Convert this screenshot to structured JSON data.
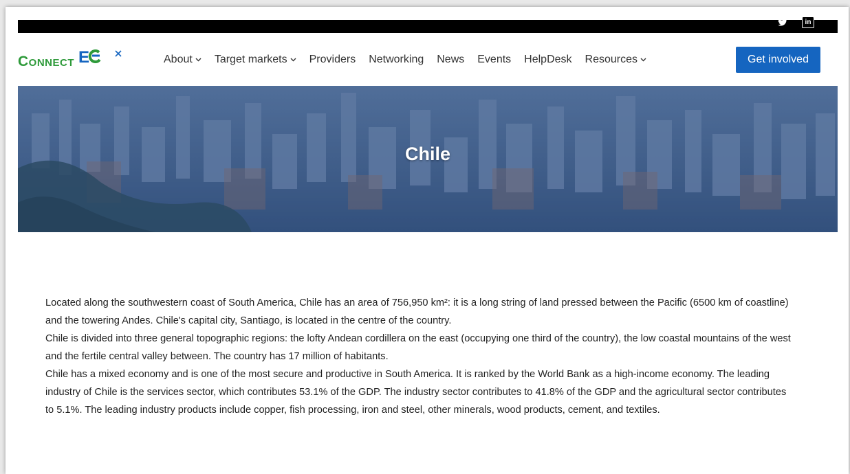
{
  "logo": {
    "connect": "Connect",
    "eo": "EO"
  },
  "nav": {
    "items": [
      {
        "label": "About",
        "dropdown": true
      },
      {
        "label": "Target markets",
        "dropdown": true
      },
      {
        "label": "Providers",
        "dropdown": false
      },
      {
        "label": "Networking",
        "dropdown": false
      },
      {
        "label": "News",
        "dropdown": false
      },
      {
        "label": "Events",
        "dropdown": false
      },
      {
        "label": "HelpDesk",
        "dropdown": false
      },
      {
        "label": "Resources",
        "dropdown": true
      }
    ],
    "cta": "Get involved"
  },
  "social": {
    "twitter_icon": "twitter-icon",
    "linkedin": "in"
  },
  "hero": {
    "title": "Chile"
  },
  "content": {
    "paragraphs": [
      "Located along the southwestern coast of South America, Chile has an area of 756,950 km²: it is a long string of land pressed between the Pacific (6500 km of coastline) and the towering Andes. Chile's capital city, Santiago, is located in the centre of the country.",
      "Chile is divided into three general topographic regions: the lofty Andean cordillera on the east (occupying one third of the country), the low coastal mountains of the west and the fertile central valley between. The country has 17 million of habitants.",
      "Chile has a mixed economy and is one of the most secure and productive in South America. It is ranked by the World Bank as a high-income economy. The leading industry of Chile is the services sector, which contributes 53.1% of the GDP. The industry sector contributes to 41.8% of the GDP and the agricultural sector contributes to 5.1%. The leading industry products include copper, fish processing, iron and steel, other minerals, wood products, cement, and textiles."
    ]
  },
  "colors": {
    "brand_green": "#2e9a3a",
    "brand_blue": "#1565c0",
    "hero_overlay": "#3e5b85"
  }
}
